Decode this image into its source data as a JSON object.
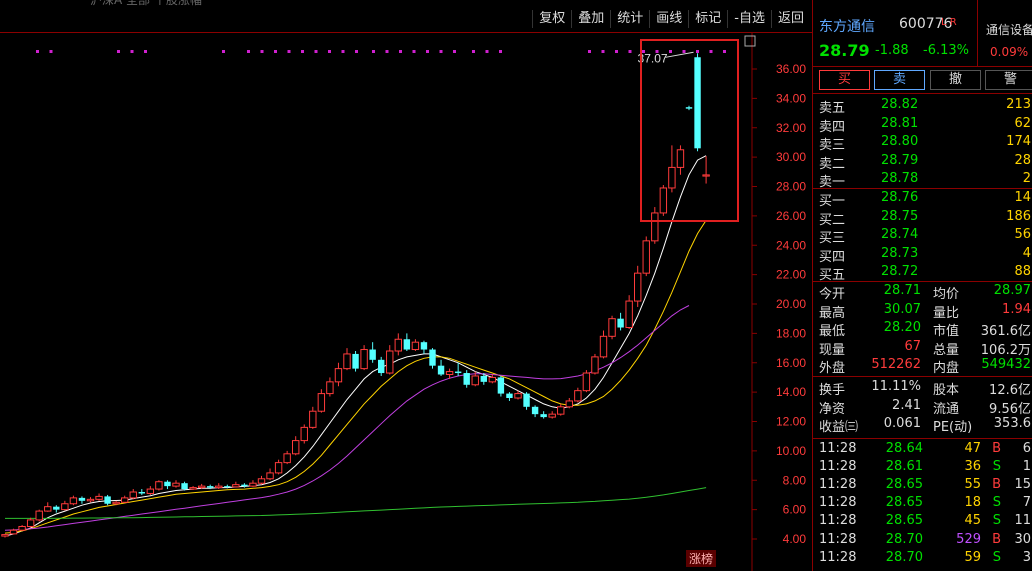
{
  "toolbar": {
    "title_clip": "沪深A 全部 个股涨幅",
    "buttons": [
      "复权",
      "叠加",
      "统计",
      "画线",
      "标记",
      "-自选",
      "返回"
    ]
  },
  "chart_data": {
    "type": "candlestick",
    "ylim": [
      3.0,
      38.0
    ],
    "yticks": [
      "36.00",
      "34.00",
      "32.00",
      "30.00",
      "28.00",
      "26.00",
      "24.00",
      "22.00",
      "20.00",
      "18.00",
      "16.00",
      "14.00",
      "12.00",
      "10.00",
      "8.00",
      "6.00",
      "4.00"
    ],
    "candles": [
      [
        4.2,
        4.3,
        4.1,
        4.35
      ],
      [
        4.35,
        4.6,
        4.3,
        4.7
      ],
      [
        4.6,
        4.85,
        4.55,
        4.95
      ],
      [
        4.85,
        5.3,
        4.8,
        5.45
      ],
      [
        5.3,
        5.9,
        5.2,
        6.0
      ],
      [
        5.9,
        6.2,
        5.85,
        6.5
      ],
      [
        6.2,
        6.0,
        5.8,
        6.3
      ],
      [
        6.0,
        6.4,
        5.95,
        6.6
      ],
      [
        6.4,
        6.8,
        6.3,
        6.95
      ],
      [
        6.8,
        6.6,
        6.4,
        6.9
      ],
      [
        6.6,
        6.7,
        6.5,
        6.85
      ],
      [
        6.7,
        6.9,
        6.6,
        7.1
      ],
      [
        6.9,
        6.4,
        6.3,
        7.0
      ],
      [
        6.4,
        6.5,
        6.3,
        6.6
      ],
      [
        6.5,
        6.8,
        6.45,
        6.95
      ],
      [
        6.8,
        7.2,
        6.7,
        7.4
      ],
      [
        7.2,
        7.1,
        7.0,
        7.4
      ],
      [
        7.1,
        7.4,
        7.0,
        7.6
      ],
      [
        7.4,
        7.9,
        7.3,
        8.0
      ],
      [
        7.9,
        7.6,
        7.4,
        8.0
      ],
      [
        7.6,
        7.8,
        7.5,
        8.0
      ],
      [
        7.8,
        7.4,
        7.3,
        7.9
      ],
      [
        7.4,
        7.5,
        7.35,
        7.6
      ],
      [
        7.5,
        7.6,
        7.4,
        7.75
      ],
      [
        7.6,
        7.5,
        7.4,
        7.7
      ],
      [
        7.5,
        7.6,
        7.4,
        7.8
      ],
      [
        7.6,
        7.55,
        7.45,
        7.7
      ],
      [
        7.55,
        7.7,
        7.5,
        7.9
      ],
      [
        7.7,
        7.6,
        7.5,
        7.8
      ],
      [
        7.6,
        7.8,
        7.55,
        8.0
      ],
      [
        7.8,
        8.1,
        7.7,
        8.3
      ],
      [
        8.1,
        8.5,
        8.0,
        8.8
      ],
      [
        8.5,
        9.2,
        8.4,
        9.4
      ],
      [
        9.2,
        9.8,
        9.1,
        10.0
      ],
      [
        9.8,
        10.7,
        9.7,
        11.0
      ],
      [
        10.7,
        11.6,
        10.5,
        11.8
      ],
      [
        11.6,
        12.7,
        11.5,
        13.0
      ],
      [
        12.7,
        13.9,
        12.6,
        14.2
      ],
      [
        13.9,
        14.7,
        13.7,
        15.0
      ],
      [
        14.7,
        15.6,
        14.4,
        16.0
      ],
      [
        15.6,
        16.6,
        15.5,
        17.0
      ],
      [
        16.6,
        15.6,
        15.4,
        16.8
      ],
      [
        15.6,
        16.9,
        15.5,
        17.2
      ],
      [
        16.9,
        16.2,
        16.0,
        17.4
      ],
      [
        16.2,
        15.3,
        15.1,
        16.4
      ],
      [
        15.3,
        16.8,
        15.2,
        17.2
      ],
      [
        16.8,
        17.6,
        16.5,
        18.0
      ],
      [
        17.6,
        16.9,
        16.8,
        18.0
      ],
      [
        16.9,
        17.4,
        16.8,
        17.6
      ],
      [
        17.4,
        16.9,
        16.6,
        17.5
      ],
      [
        16.9,
        15.8,
        15.6,
        17.0
      ],
      [
        15.8,
        15.2,
        15.1,
        16.2
      ],
      [
        15.2,
        15.4,
        14.9,
        15.6
      ],
      [
        15.4,
        15.3,
        15.1,
        16.0
      ],
      [
        15.3,
        14.5,
        14.3,
        15.5
      ],
      [
        14.5,
        15.1,
        14.4,
        15.4
      ],
      [
        15.1,
        14.7,
        14.5,
        15.3
      ],
      [
        14.7,
        15.0,
        14.6,
        15.2
      ],
      [
        15.0,
        13.9,
        13.7,
        15.1
      ],
      [
        13.9,
        13.6,
        13.4,
        14.0
      ],
      [
        13.6,
        13.9,
        13.5,
        14.1
      ],
      [
        13.9,
        13.0,
        12.8,
        14.0
      ],
      [
        13.0,
        12.5,
        12.3,
        13.1
      ],
      [
        12.5,
        12.3,
        12.2,
        12.7
      ],
      [
        12.3,
        12.5,
        12.2,
        12.7
      ],
      [
        12.5,
        13.0,
        12.4,
        13.2
      ],
      [
        13.0,
        13.4,
        12.9,
        13.6
      ],
      [
        13.4,
        14.1,
        13.3,
        14.3
      ],
      [
        14.1,
        15.3,
        14.0,
        15.5
      ],
      [
        15.3,
        16.4,
        15.2,
        16.6
      ],
      [
        16.4,
        17.8,
        16.3,
        18.2
      ],
      [
        17.8,
        19.0,
        17.6,
        19.2
      ],
      [
        19.0,
        18.4,
        18.2,
        19.4
      ],
      [
        18.4,
        20.2,
        18.3,
        20.6
      ],
      [
        20.2,
        22.1,
        19.8,
        22.6
      ],
      [
        22.1,
        24.3,
        21.9,
        24.6
      ],
      [
        24.3,
        26.2,
        24.1,
        26.6
      ],
      [
        26.2,
        27.9,
        26.0,
        28.1
      ],
      [
        27.9,
        29.3,
        27.6,
        30.8
      ],
      [
        29.3,
        30.5,
        28.8,
        30.8
      ],
      [
        33.4,
        33.3,
        33.2,
        33.5
      ],
      [
        36.8,
        30.6,
        30.4,
        37.07
      ],
      [
        28.71,
        28.79,
        28.2,
        30.07
      ]
    ],
    "ma_series": [
      {
        "color": "#ffffff",
        "values": [
          4.2,
          4.35,
          4.55,
          4.75,
          5.1,
          5.45,
          5.7,
          5.9,
          6.1,
          6.3,
          6.45,
          6.55,
          6.6,
          6.62,
          6.65,
          6.75,
          6.85,
          6.95,
          7.1,
          7.2,
          7.3,
          7.35,
          7.4,
          7.45,
          7.45,
          7.5,
          7.5,
          7.55,
          7.58,
          7.62,
          7.7,
          7.85,
          8.1,
          8.5,
          9.0,
          9.6,
          10.3,
          11.1,
          11.9,
          12.7,
          13.5,
          14.2,
          14.9,
          15.4,
          15.7,
          15.9,
          16.2,
          16.4,
          16.5,
          16.6,
          16.6,
          16.4,
          16.2,
          16.0,
          15.7,
          15.4,
          15.2,
          15.0,
          14.7,
          14.4,
          14.1,
          13.8,
          13.5,
          13.2,
          13.0,
          12.9,
          13.0,
          13.2,
          13.6,
          14.2,
          15.0,
          16.0,
          17.0,
          18.0,
          19.2,
          20.6,
          22.1,
          23.8,
          25.6,
          27.3,
          28.8,
          29.8,
          30.1
        ]
      },
      {
        "color": "#ffd400",
        "values": [
          4.4,
          4.45,
          4.55,
          4.7,
          4.9,
          5.1,
          5.3,
          5.5,
          5.7,
          5.85,
          6.0,
          6.15,
          6.25,
          6.35,
          6.45,
          6.55,
          6.65,
          6.75,
          6.85,
          6.95,
          7.05,
          7.1,
          7.15,
          7.2,
          7.25,
          7.3,
          7.35,
          7.38,
          7.4,
          7.45,
          7.5,
          7.58,
          7.7,
          7.9,
          8.2,
          8.6,
          9.1,
          9.7,
          10.4,
          11.1,
          11.8,
          12.5,
          13.2,
          13.8,
          14.4,
          14.9,
          15.4,
          15.8,
          16.1,
          16.3,
          16.4,
          16.4,
          16.3,
          16.1,
          15.9,
          15.7,
          15.5,
          15.3,
          15.1,
          14.9,
          14.6,
          14.3,
          14.0,
          13.7,
          13.4,
          13.2,
          13.1,
          13.1,
          13.2,
          13.4,
          13.7,
          14.2,
          14.8,
          15.5,
          16.3,
          17.2,
          18.3,
          19.5,
          20.8,
          22.2,
          23.6,
          24.8,
          25.7
        ]
      },
      {
        "color": "#c040e0",
        "values": [
          4.6,
          4.62,
          4.65,
          4.7,
          4.75,
          4.82,
          4.9,
          4.98,
          5.06,
          5.14,
          5.22,
          5.3,
          5.38,
          5.46,
          5.54,
          5.62,
          5.7,
          5.78,
          5.86,
          5.94,
          6.02,
          6.1,
          6.18,
          6.26,
          6.34,
          6.42,
          6.5,
          6.58,
          6.66,
          6.74,
          6.82,
          6.92,
          7.05,
          7.2,
          7.4,
          7.65,
          7.95,
          8.3,
          8.7,
          9.15,
          9.65,
          10.2,
          10.75,
          11.3,
          11.85,
          12.4,
          12.9,
          13.4,
          13.8,
          14.2,
          14.5,
          14.75,
          14.95,
          15.1,
          15.2,
          15.25,
          15.25,
          15.2,
          15.15,
          15.1,
          15.05,
          15.0,
          14.95,
          14.9,
          14.9,
          14.92,
          15.0,
          15.1,
          15.25,
          15.45,
          15.7,
          16.0,
          16.35,
          16.75,
          17.2,
          17.7,
          18.2,
          18.7,
          19.2,
          19.6,
          19.9
        ]
      },
      {
        "color": "#30c030",
        "values": [
          5.4,
          5.4,
          5.4,
          5.4,
          5.4,
          5.4,
          5.41,
          5.41,
          5.42,
          5.42,
          5.43,
          5.43,
          5.44,
          5.44,
          5.45,
          5.45,
          5.46,
          5.47,
          5.48,
          5.49,
          5.5,
          5.51,
          5.52,
          5.53,
          5.54,
          5.55,
          5.56,
          5.57,
          5.58,
          5.59,
          5.6,
          5.62,
          5.64,
          5.66,
          5.68,
          5.7,
          5.73,
          5.76,
          5.79,
          5.82,
          5.85,
          5.88,
          5.91,
          5.94,
          5.97,
          6.0,
          6.03,
          6.06,
          6.09,
          6.12,
          6.15,
          6.18,
          6.2,
          6.22,
          6.24,
          6.26,
          6.28,
          6.3,
          6.32,
          6.34,
          6.36,
          6.38,
          6.4,
          6.42,
          6.44,
          6.46,
          6.48,
          6.5,
          6.53,
          6.56,
          6.6,
          6.64,
          6.68,
          6.72,
          6.78,
          6.84,
          6.92,
          7.0,
          7.1,
          7.2,
          7.3,
          7.4,
          7.5
        ]
      }
    ],
    "annotations": {
      "high_label": "37.07",
      "zt_label": "涨榜"
    }
  },
  "quote": {
    "name": "东方通信",
    "code": "600776",
    "lr": "L R",
    "last": "28.79",
    "change": "-1.88",
    "pct": "-6.13%",
    "sector_name": "通信设备",
    "sector_pct": "0.09%"
  },
  "trade_buttons": [
    "买",
    "卖",
    "撤",
    "警"
  ],
  "sell_book": [
    [
      "卖五",
      "28.82",
      "213"
    ],
    [
      "卖四",
      "28.81",
      "62"
    ],
    [
      "卖三",
      "28.80",
      "174"
    ],
    [
      "卖二",
      "28.79",
      "28"
    ],
    [
      "卖一",
      "28.78",
      "2"
    ]
  ],
  "buy_book": [
    [
      "买一",
      "28.76",
      "14"
    ],
    [
      "买二",
      "28.75",
      "186"
    ],
    [
      "买三",
      "28.74",
      "56"
    ],
    [
      "买四",
      "28.73",
      "4"
    ],
    [
      "买五",
      "28.72",
      "88"
    ]
  ],
  "stats1": [
    [
      "今开",
      "28.71",
      "均价",
      "28.97"
    ],
    [
      "最高",
      "30.07",
      "量比",
      "1.94"
    ],
    [
      "最低",
      "28.20",
      "市值",
      "361.6亿"
    ],
    [
      "现量",
      "67",
      "总量",
      "106.2万"
    ],
    [
      "外盘",
      "512262",
      "内盘",
      "549432"
    ]
  ],
  "stats2": [
    [
      "换手",
      "11.11%",
      "股本",
      "12.6亿"
    ],
    [
      "净资",
      "2.41",
      "流通",
      "9.56亿"
    ],
    [
      "收益㈢",
      "0.061",
      "PE(动)",
      "353.6"
    ]
  ],
  "ticks": [
    [
      "11:28",
      "28.64",
      "47",
      "B",
      "6"
    ],
    [
      "11:28",
      "28.61",
      "36",
      "S",
      "1"
    ],
    [
      "11:28",
      "28.65",
      "55",
      "B",
      "15"
    ],
    [
      "11:28",
      "28.65",
      "18",
      "S",
      "7"
    ],
    [
      "11:28",
      "28.65",
      "45",
      "S",
      "11"
    ],
    [
      "11:28",
      "28.70",
      "529",
      "B",
      "30"
    ],
    [
      "11:28",
      "28.70",
      "59",
      "S",
      "3"
    ]
  ]
}
